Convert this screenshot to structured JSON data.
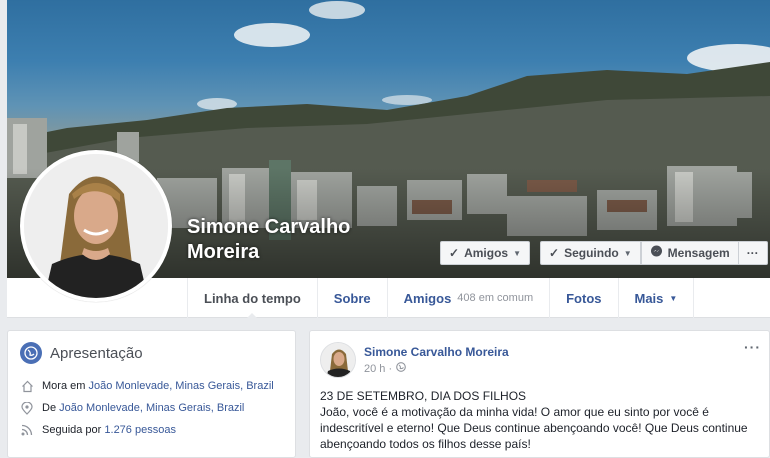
{
  "profile": {
    "name": "Simone Carvalho Moreira"
  },
  "cover_actions": {
    "friends_label": "Amigos",
    "following_label": "Seguindo",
    "message_label": "Mensagem",
    "more_label": "···"
  },
  "tabs": [
    {
      "label": "Linha do tempo"
    },
    {
      "label": "Sobre"
    },
    {
      "label": "Amigos",
      "sub": "408 em comum"
    },
    {
      "label": "Fotos"
    },
    {
      "label": "Mais"
    }
  ],
  "intro": {
    "title": "Apresentação",
    "lives_prefix": "Mora em",
    "lives_place": "João Monlevade, Minas Gerais, Brazil",
    "from_prefix": "De",
    "from_place": "João Monlevade, Minas Gerais, Brazil",
    "followers_prefix": "Seguida por",
    "followers_value": "1.276 pessoas"
  },
  "post": {
    "author": "Simone Carvalho Moreira",
    "time": "20 h ·",
    "more": "···",
    "line1": "23 DE SETEMBRO, DIA DOS FILHOS",
    "line2": "João, você é a motivação da minha vida! O amor que eu sinto por você é indescritível e eterno! Que Deus continue abençoando você! Que Deus continue abençoando todos os filhos desse país!"
  },
  "colors": {
    "link": "#385898",
    "page_bg": "#e9ebee",
    "globe": "#4a6fb5"
  },
  "icons": [
    "check-icon",
    "caret-down-icon",
    "messenger-icon",
    "globe-icon",
    "home-icon",
    "location-pin-icon",
    "rss-icon",
    "public-globe-icon"
  ]
}
